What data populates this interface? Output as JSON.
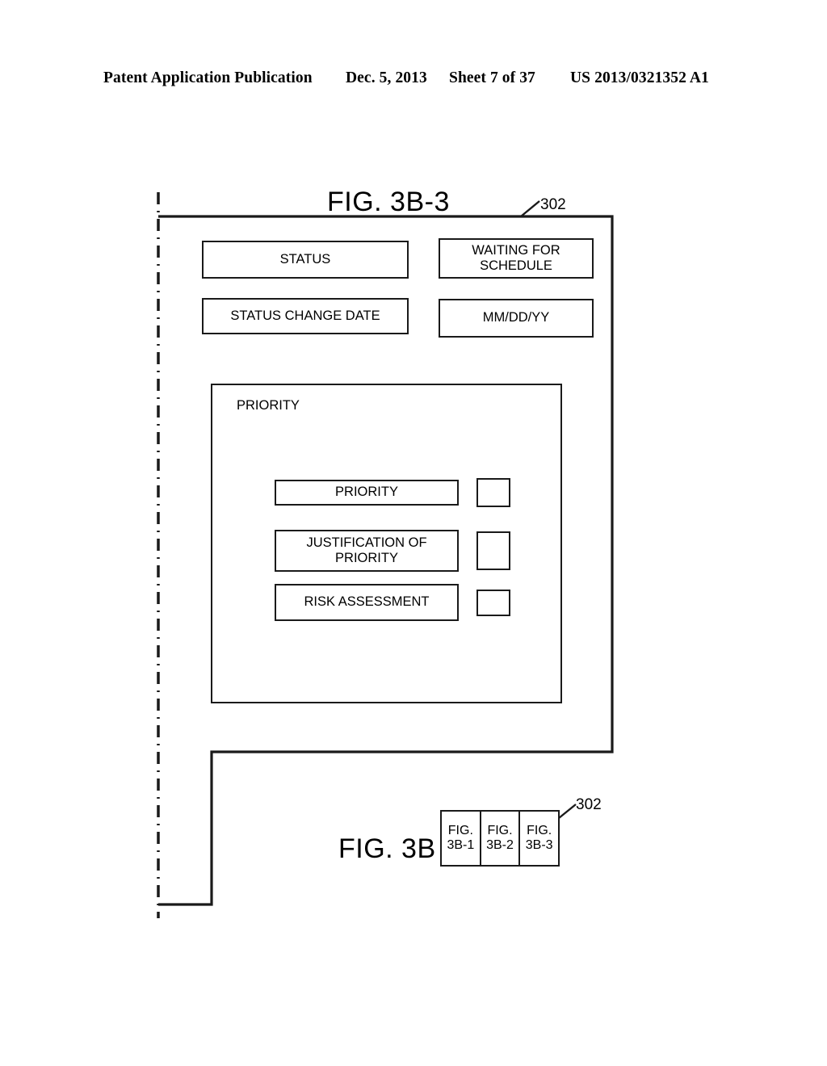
{
  "page_header": {
    "publication": "Patent Application Publication",
    "date": "Dec. 5, 2013",
    "sheet": "Sheet 7 of 37",
    "patent_number": "US 2013/0321352 A1"
  },
  "figure": {
    "title": "FIG. 3B-3",
    "reference_numeral": "302",
    "rows": [
      {
        "label": "STATUS",
        "value": "WAITING FOR SCHEDULE"
      },
      {
        "label": "STATUS CHANGE DATE",
        "value": "MM/DD/YY"
      }
    ],
    "priority_group": {
      "label": "PRIORITY",
      "items": [
        {
          "label": "PRIORITY",
          "value": ""
        },
        {
          "label": "JUSTIFICATION OF PRIORITY",
          "value": ""
        },
        {
          "label": "RISK ASSESSMENT",
          "value": ""
        }
      ]
    }
  },
  "key": {
    "title": "FIG. 3B",
    "reference_numeral": "302",
    "cells": [
      {
        "line1": "FIG.",
        "line2": "3B-1"
      },
      {
        "line1": "FIG.",
        "line2": "3B-2"
      },
      {
        "line1": "FIG.",
        "line2": "3B-3"
      }
    ]
  },
  "colors": {
    "ink": "#1a1a1a",
    "paper": "#ffffff"
  }
}
